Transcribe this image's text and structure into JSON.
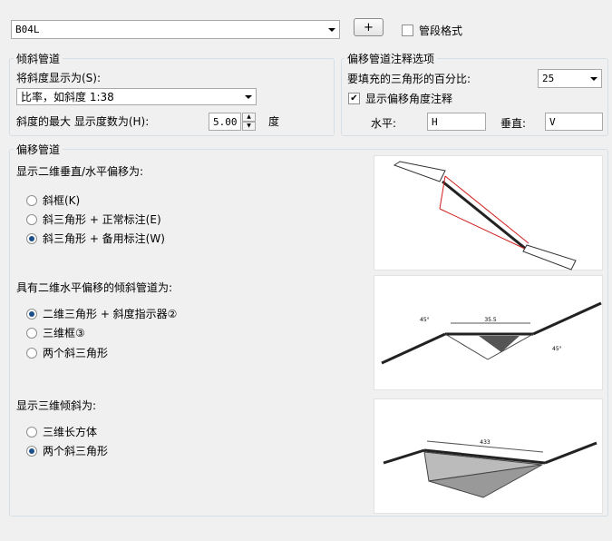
{
  "top": {
    "style_value": "B04L",
    "add_button_label": "+",
    "pipe_format_label": "管段格式"
  },
  "slope_pipe": {
    "group_label": "倾斜管道",
    "display_as_label": "将斜度显示为(S):",
    "display_as_value": "比率，如斜度 1:38",
    "max_slope_label": "斜度的最大  显示度数为(H):",
    "max_slope_value": "5.00",
    "degree_unit": "度"
  },
  "offset_annot": {
    "group_label": "偏移管道注释选项",
    "triangle_percent_label": "要填充的三角形的百分比:",
    "triangle_percent_value": "25",
    "show_angle_label": "显示偏移角度注释",
    "horizontal_label": "水平:",
    "horizontal_value": "H",
    "vertical_label": "垂直:",
    "vertical_value": "V"
  },
  "offset_pipe": {
    "group_label": "偏移管道",
    "section1": {
      "title": "显示二维垂直/水平偏移为:",
      "options": [
        "斜框(K)",
        "斜三角形 + 正常标注(E)",
        "斜三角形 + 备用标注(W)"
      ],
      "selected": 2
    },
    "section2": {
      "title": "具有二维水平偏移的倾斜管道为:",
      "options": [
        "二维三角形 + 斜度指示器②",
        "三维框③",
        "两个斜三角形"
      ],
      "selected": 0
    },
    "section3": {
      "title": "显示三维倾斜为:",
      "options": [
        "三维长方体",
        "两个斜三角形"
      ],
      "selected": 1
    }
  },
  "previews": {
    "p2_top_dim": "35.5",
    "p2_angle_left": "45°",
    "p2_angle_right": "45°",
    "p3_top_dim": "433"
  },
  "colors": {
    "accent": "#1a4f8a",
    "offset_red": "#d02020"
  }
}
